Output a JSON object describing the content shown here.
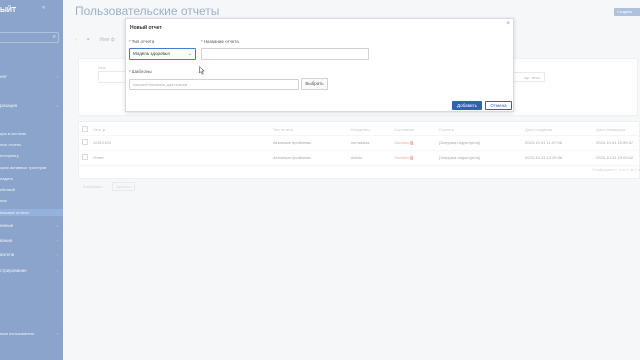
{
  "sidebar": {
    "brand": "ЫЙТ",
    "collapse_icon": "double-chevron-left-icon",
    "search_icon": "search-icon",
    "items": [
      {
        "label": "нят",
        "chev": "›",
        "big": true
      },
      {
        "label": "",
        "chev": "›",
        "big": true
      },
      {
        "label": "ризация",
        "chev": "›",
        "big": true
      },
      {
        "label": "ция в системе",
        "chev": "",
        "big": false
      },
      {
        "label": "ные отчеты",
        "chev": "",
        "big": false
      },
      {
        "label": "ниторингу",
        "chev": "",
        "big": false
      },
      {
        "label": "ория активных триггеров",
        "chev": "",
        "big": false
      },
      {
        "label": "ладить",
        "chev": "",
        "big": false
      },
      {
        "label": "ействий",
        "chev": "",
        "big": false
      },
      {
        "label": "ния",
        "chev": "",
        "big": false
      },
      {
        "label": "ельские отчеты",
        "chev": "",
        "big": false,
        "active": true
      },
      {
        "label": "енные",
        "chev": "›",
        "big": true
      },
      {
        "label": "вание",
        "chev": "›",
        "big": true
      },
      {
        "label": "ватели",
        "chev": "›",
        "big": true
      },
      {
        "label": "стрирование",
        "chev": "›",
        "big": true
      },
      {
        "label": "ным пользователя",
        "chev": "›",
        "big": false
      }
    ]
  },
  "header": {
    "title": "Пользовательские отчеты",
    "create_label": "Создать"
  },
  "toolbar": {
    "back": "‹",
    "filter_icon": "filter-icon",
    "label": "Имя ф"
  },
  "filter": {
    "name_label": "Имя",
    "reset_label": "ыр. весь"
  },
  "table": {
    "columns": [
      "Имя ▲",
      "Тип отчета",
      "Владелец",
      "Состояние",
      "Скачать",
      "Дата создания",
      "Дата генерации"
    ],
    "rows": [
      {
        "name": "12312123",
        "type": "Активные проблемы",
        "owner": "me.adidas",
        "state": "Ошибка",
        "download": "[Загрузка недоступна]",
        "created": "2023-10-31 11:07:06",
        "generated": "2023-10-31 10:59:37"
      },
      {
        "name": "Отчет",
        "type": "Активные проблемы",
        "owner": "Admin",
        "state": "Ошибка",
        "download": "[Загрузка недоступна]",
        "created": "2023-10-31 13:39:36",
        "generated": "2023-10-31 13:09:42"
      }
    ],
    "badge": "!",
    "pager_info": "Отображено с 1 по 2 из 2 н",
    "selected_label": "0 выбрано",
    "delete_label": "Удалить"
  },
  "modal": {
    "title": "Новый отчет",
    "close": "×",
    "type_label": "Тип отчета",
    "type_value": "Модель здоровья",
    "name_label": "Название отчета",
    "name_value": "",
    "template_label": "Шаблоны",
    "template_placeholder": "начните печатать для поиска",
    "choose_label": "Выбрать",
    "add_label": "Добавить",
    "cancel_label": "Отмена",
    "required_mark": "*",
    "dropdown_icon": "chevron-down-icon"
  },
  "colors": {
    "sidebar_bg": "#2c5aa0",
    "primary": "#2f62b5",
    "error": "#e7776a"
  }
}
